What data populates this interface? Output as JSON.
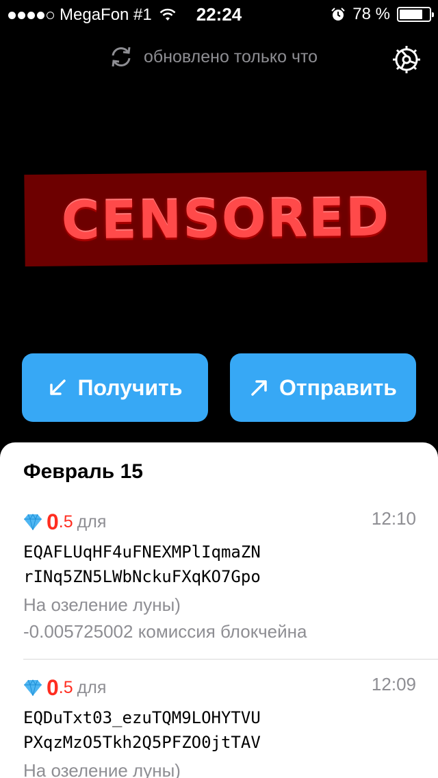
{
  "status_bar": {
    "carrier": "MegaFon #1",
    "time": "22:24",
    "battery_percent": "78 %",
    "battery_level": 0.78,
    "signal_bars_filled": 4,
    "signal_bars_total": 5
  },
  "header": {
    "sync_status": "обновлено только что"
  },
  "balance": {
    "censor_text": "CENSORED"
  },
  "actions": {
    "receive_label": "Получить",
    "send_label": "Отправить"
  },
  "transactions": {
    "date_header": "Февраль 15",
    "items": [
      {
        "amount_int": "0",
        "amount_frac": ".5",
        "direction_label": "для",
        "time": "12:10",
        "address_line1": "EQAFLUqHF4uFNEXMPlIqmaZN",
        "address_line2": "rINq5ZN5LWbNckuFXqKO7Gpo",
        "comment": "На озеление луны)",
        "fee": "-0.005725002 комиссия блокчейна"
      },
      {
        "amount_int": "0",
        "amount_frac": ".5",
        "direction_label": "для",
        "time": "12:09",
        "address_line1": "EQDuTxt03_ezuTQM9LOHYTVU",
        "address_line2": "PXqzMzO5Tkh2Q5PFZO0jtTAV",
        "comment": "На озеление луны)"
      }
    ]
  },
  "colors": {
    "accent": "#37a8f5",
    "negative_amount": "#ff2d20",
    "secondary_text": "#8e8e93",
    "censor_background": "#6d0000"
  }
}
